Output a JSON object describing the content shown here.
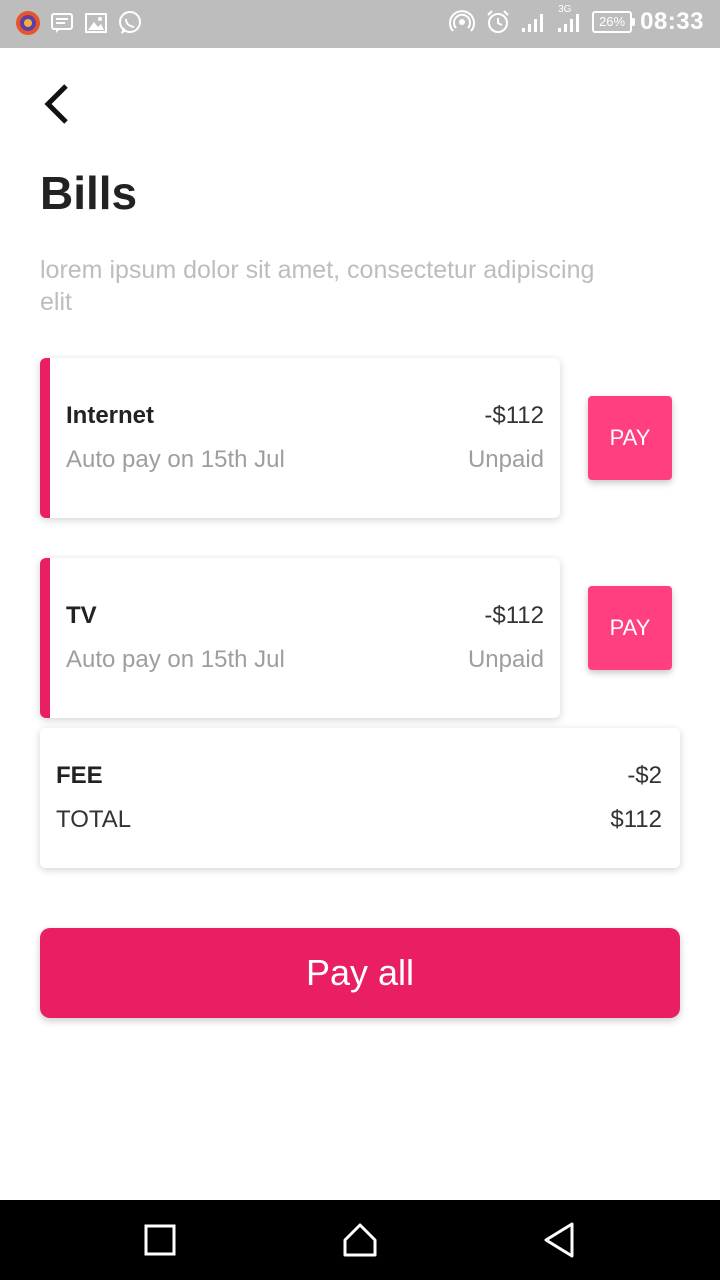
{
  "status_bar": {
    "battery": "26%",
    "time": "08:33",
    "network_label": "3G"
  },
  "page": {
    "title": "Bills",
    "subtitle": "lorem ipsum dolor sit amet, consectetur adipiscing elit"
  },
  "bills": [
    {
      "name": "Internet",
      "amount": "-$112",
      "autopay": "Auto pay on 15th Jul",
      "status": "Unpaid",
      "pay_label": "PAY"
    },
    {
      "name": "TV",
      "amount": "-$112",
      "autopay": "Auto pay on 15th Jul",
      "status": "Unpaid",
      "pay_label": "PAY"
    }
  ],
  "summary": {
    "fee_label": "FEE",
    "fee_value": "-$2",
    "total_label": "TOTAL",
    "total_value": "$112"
  },
  "pay_all_label": "Pay all",
  "colors": {
    "accent": "#e91e63",
    "pay_button": "#ff3f7f",
    "subtitle": "#bdbdbd",
    "status_bar": "#bdbdbd"
  }
}
